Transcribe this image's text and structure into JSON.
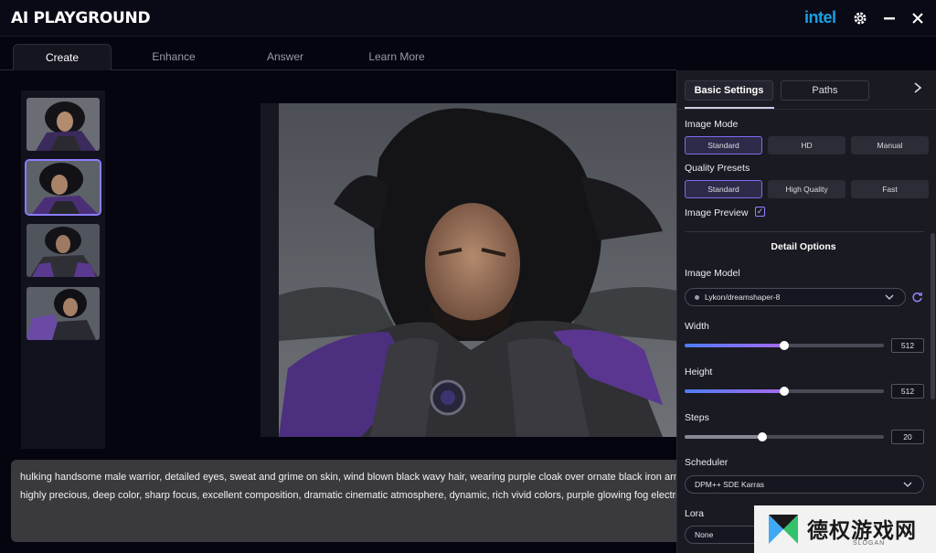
{
  "app": {
    "title": "AI PLAYGROUND",
    "brand": "intel"
  },
  "window_controls": {
    "settings": "gear-icon",
    "minimize": "minimize-icon",
    "close": "close-icon"
  },
  "tabs": [
    {
      "label": "Create",
      "active": true
    },
    {
      "label": "Enhance",
      "active": false
    },
    {
      "label": "Answer",
      "active": false
    },
    {
      "label": "Learn More",
      "active": false
    }
  ],
  "thumbnails": {
    "count": 4,
    "selected_index": 1
  },
  "prompt": {
    "line1": "hulking handsome male warrior, detailed eyes, sweat and grime on skin, wind blown black wavy hair, wearing purple cloak over ornate black iron armo",
    "line2": "highly precious, deep color, sharp focus, excellent composition, dramatic cinematic atmosphere, dynamic, rich vivid colors, purple glowing fog electri"
  },
  "panel": {
    "tabs": [
      {
        "label": "Basic Settings",
        "active": true
      },
      {
        "label": "Paths",
        "active": false
      }
    ],
    "image_mode": {
      "label": "Image Mode",
      "options": [
        "Standard",
        "HD",
        "Manual"
      ],
      "selected": "Standard"
    },
    "quality_presets": {
      "label": "Quality Presets",
      "options": [
        "Standard",
        "High Quality",
        "Fast"
      ],
      "selected": "Standard"
    },
    "image_preview": {
      "label": "Image Preview",
      "checked": true,
      "check_glyph": "✓"
    },
    "detail_options": {
      "title": "Detail Options"
    },
    "image_model": {
      "label": "Image Model",
      "value": "Lykon/dreamshaper-8"
    },
    "width": {
      "label": "Width",
      "value": "512",
      "fraction": 0.5
    },
    "height": {
      "label": "Height",
      "value": "512",
      "fraction": 0.5
    },
    "steps": {
      "label": "Steps",
      "value": "20",
      "fraction": 0.39
    },
    "scheduler": {
      "label": "Scheduler",
      "value": "DPM++ SDE Karras"
    },
    "lora": {
      "label": "Lora",
      "value": "None"
    }
  },
  "watermark": {
    "text": "德权游戏网",
    "slogan": "SLOGAN"
  },
  "colors": {
    "accent": "#7f6bf0",
    "intel_blue": "#19a0e6",
    "slider_from": "#4f7cf5",
    "slider_to": "#a46bf0"
  }
}
